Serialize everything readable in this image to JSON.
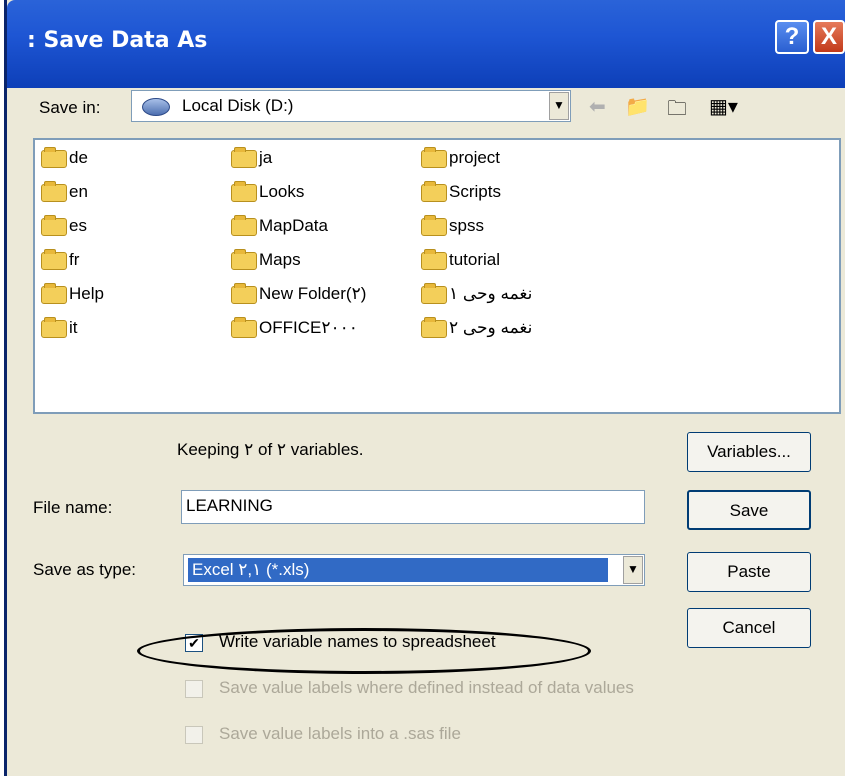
{
  "dialog": {
    "title": ": Save Data As",
    "help_glyph": "?",
    "close_glyph": "X"
  },
  "save_in": {
    "label": "Save in:",
    "value": "Local Disk (D:)"
  },
  "toolbar": {
    "back_icon": "back-arrow-icon",
    "up_icon": "up-folder-icon",
    "new_folder_icon": "new-folder-icon",
    "view_icon": "view-menu-icon"
  },
  "files": [
    "de",
    "en",
    "es",
    "fr",
    "Help",
    "it",
    "ja",
    "Looks",
    "MapData",
    "Maps",
    "New Folder(٢)",
    "OFFICE٢٠٠٠",
    "project",
    "Scripts",
    "spss",
    "tutorial",
    "نغمه وحی ١",
    "نغمه وحی ٢"
  ],
  "keeping_text": "Keeping ٢ of ٢ variables.",
  "file_name": {
    "label": "File name:",
    "value": "LEARNING"
  },
  "save_as_type": {
    "label": "Save as type:",
    "value": "Excel ٢,١ (*.xls)"
  },
  "buttons": {
    "variables": "Variables...",
    "save": "Save",
    "paste": "Paste",
    "cancel": "Cancel"
  },
  "checkboxes": [
    {
      "label": "Write variable names to spreadsheet",
      "checked": true,
      "enabled": true
    },
    {
      "label": "Save value labels where defined instead of data values",
      "checked": false,
      "enabled": false
    },
    {
      "label": "Save value labels into a .sas file",
      "checked": false,
      "enabled": false
    }
  ]
}
